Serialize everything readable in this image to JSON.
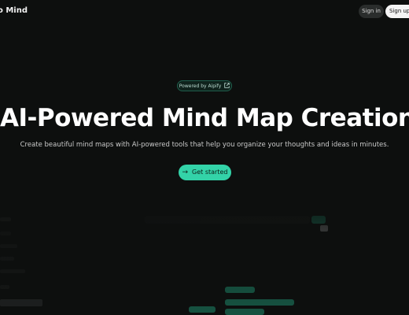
{
  "header": {
    "brand": "o Mind",
    "sign_in": "Sign in",
    "sign_up": "Sign up"
  },
  "hero": {
    "badge": "Powered by Aipify",
    "title": "AI-Powered Mind Map Creation",
    "subtitle": "Create beautiful mind maps with AI-powered tools that help you organize your thoughts and ideas in minutes.",
    "cta": "Get started"
  },
  "icons": {
    "badge_icon": "external-link-icon",
    "cta_icon": "arrow-right-icon"
  },
  "colors": {
    "background": "#0d0f0e",
    "accent": "#33d3a8",
    "badge_border": "#1f5e4c"
  }
}
